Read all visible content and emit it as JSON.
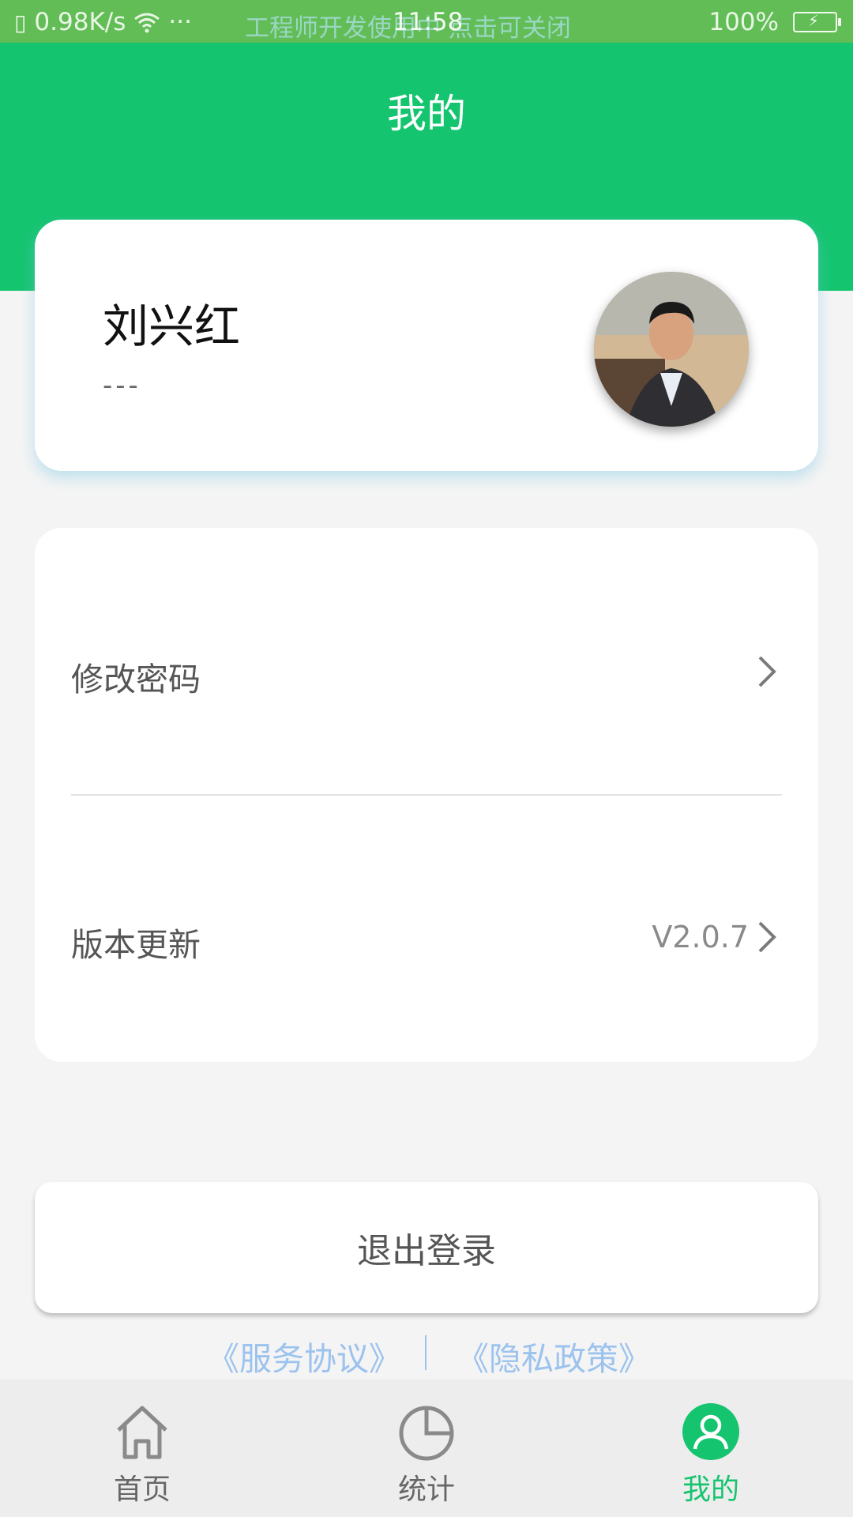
{
  "status_bar": {
    "speed": "0.98K/s",
    "banner": "工程师开发使用中 点击可关闭",
    "time": "11:58",
    "battery": "100%"
  },
  "header": {
    "title": "我的"
  },
  "profile": {
    "name": "刘兴红",
    "subtitle": "---"
  },
  "menu": {
    "items": [
      {
        "label": "修改密码",
        "value": ""
      },
      {
        "label": "版本更新",
        "value": "V2.0.7"
      }
    ]
  },
  "logout_label": "退出登录",
  "links": {
    "service": "《服务协议》",
    "privacy": "《隐私政策》"
  },
  "tabs": [
    {
      "label": "首页",
      "icon": "home-icon"
    },
    {
      "label": "统计",
      "icon": "pie-chart-icon"
    },
    {
      "label": "我的",
      "icon": "user-icon",
      "active": true
    }
  ],
  "colors": {
    "primary": "#15c46f",
    "link": "#9cc2ee",
    "status_bar": "#63bd56"
  }
}
